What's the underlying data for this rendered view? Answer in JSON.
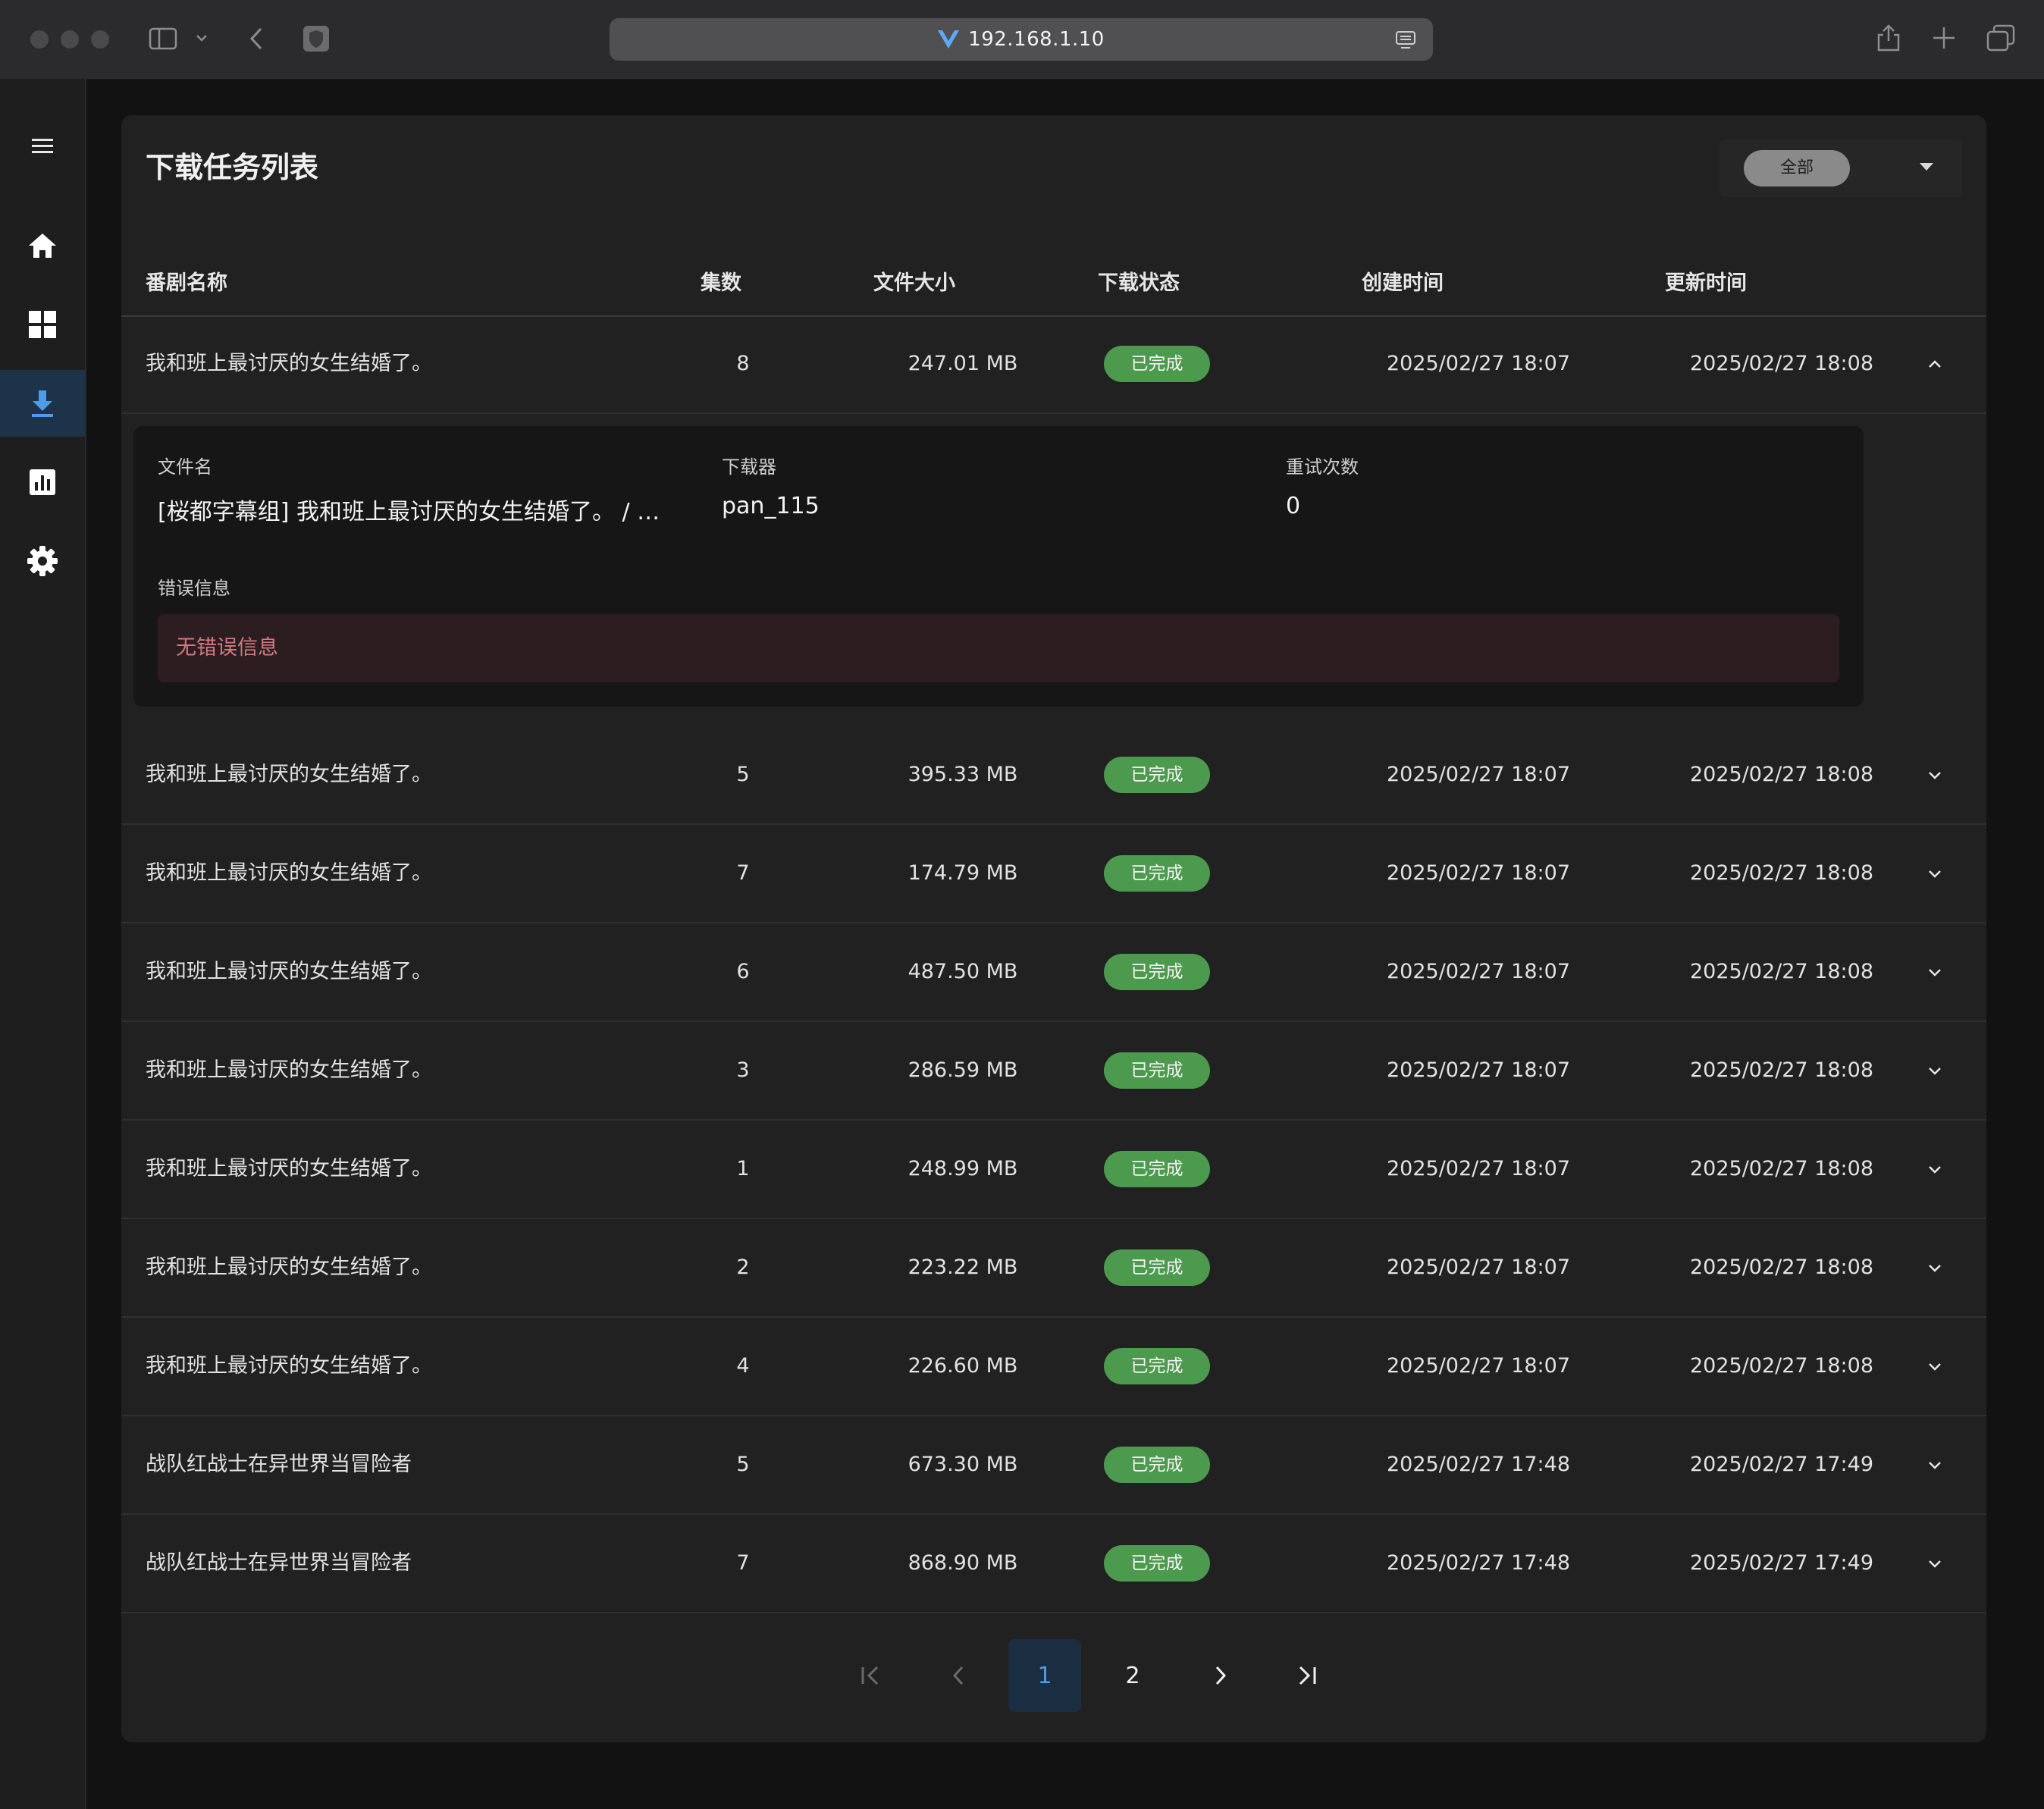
{
  "browser": {
    "url": "192.168.1.10"
  },
  "sidebar": {
    "items": [
      {
        "icon": "menu-icon"
      },
      {
        "icon": "home-icon"
      },
      {
        "icon": "dashboard-icon"
      },
      {
        "icon": "download-icon",
        "active": true
      },
      {
        "icon": "chart-icon"
      },
      {
        "icon": "gear-icon"
      }
    ]
  },
  "page": {
    "title": "下载任务列表",
    "filter_value": "全部"
  },
  "table": {
    "headers": {
      "name": "番剧名称",
      "episode": "集数",
      "size": "文件大小",
      "status": "下载状态",
      "created": "创建时间",
      "updated": "更新时间"
    },
    "rows": [
      {
        "name": "我和班上最讨厌的女生结婚了。",
        "episode": "8",
        "size": "247.01 MB",
        "status": "已完成",
        "created": "2025/02/27 18:07",
        "updated": "2025/02/27 18:08",
        "expanded": true
      },
      {
        "name": "我和班上最讨厌的女生结婚了。",
        "episode": "5",
        "size": "395.33 MB",
        "status": "已完成",
        "created": "2025/02/27 18:07",
        "updated": "2025/02/27 18:08"
      },
      {
        "name": "我和班上最讨厌的女生结婚了。",
        "episode": "7",
        "size": "174.79 MB",
        "status": "已完成",
        "created": "2025/02/27 18:07",
        "updated": "2025/02/27 18:08"
      },
      {
        "name": "我和班上最讨厌的女生结婚了。",
        "episode": "6",
        "size": "487.50 MB",
        "status": "已完成",
        "created": "2025/02/27 18:07",
        "updated": "2025/02/27 18:08"
      },
      {
        "name": "我和班上最讨厌的女生结婚了。",
        "episode": "3",
        "size": "286.59 MB",
        "status": "已完成",
        "created": "2025/02/27 18:07",
        "updated": "2025/02/27 18:08"
      },
      {
        "name": "我和班上最讨厌的女生结婚了。",
        "episode": "1",
        "size": "248.99 MB",
        "status": "已完成",
        "created": "2025/02/27 18:07",
        "updated": "2025/02/27 18:08"
      },
      {
        "name": "我和班上最讨厌的女生结婚了。",
        "episode": "2",
        "size": "223.22 MB",
        "status": "已完成",
        "created": "2025/02/27 18:07",
        "updated": "2025/02/27 18:08"
      },
      {
        "name": "我和班上最讨厌的女生结婚了。",
        "episode": "4",
        "size": "226.60 MB",
        "status": "已完成",
        "created": "2025/02/27 18:07",
        "updated": "2025/02/27 18:08"
      },
      {
        "name": "战队红战士在异世界当冒险者",
        "episode": "5",
        "size": "673.30 MB",
        "status": "已完成",
        "created": "2025/02/27 17:48",
        "updated": "2025/02/27 17:49"
      },
      {
        "name": "战队红战士在异世界当冒险者",
        "episode": "7",
        "size": "868.90 MB",
        "status": "已完成",
        "created": "2025/02/27 17:48",
        "updated": "2025/02/27 17:49"
      }
    ]
  },
  "detail": {
    "file_label": "文件名",
    "file_value": "[桜都字幕组] 我和班上最讨厌的女生结婚了。 / …",
    "downloader_label": "下载器",
    "downloader_value": "pan_115",
    "retry_label": "重试次数",
    "retry_value": "0",
    "error_label": "错误信息",
    "error_value": "无错误信息"
  },
  "pagination": {
    "pages": [
      "1",
      "2"
    ],
    "current": "1"
  },
  "colors": {
    "status_success": "#4c9a4d",
    "accent": "#4e9bea"
  }
}
